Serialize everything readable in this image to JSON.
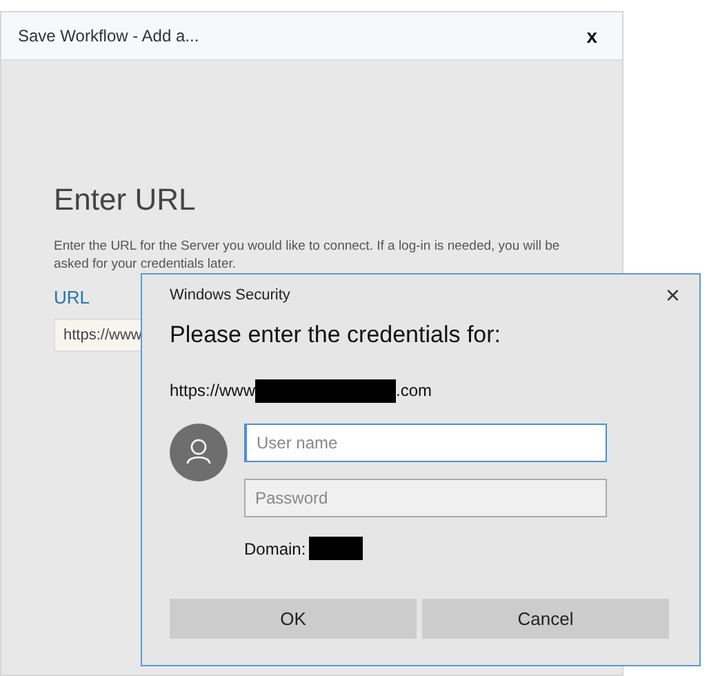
{
  "background_window": {
    "title": "Save Workflow - Add a...",
    "close": "x",
    "heading": "Enter URL",
    "description": "Enter the URL for the Server you would like to connect. If a log-in is needed, you will be asked for your credentials later.",
    "url_label": "URL",
    "url_value": "https://www"
  },
  "dialog": {
    "title": "Windows Security",
    "close": "×",
    "heading": "Please enter the credentials for:",
    "server_prefix": "https://www",
    "server_suffix": ".com",
    "fields": [
      {
        "placeholder": "User name",
        "focused": true
      },
      {
        "placeholder": "Password",
        "focused": false
      }
    ],
    "domain_label": "Domain:",
    "buttons": [
      "OK",
      "Cancel"
    ]
  }
}
